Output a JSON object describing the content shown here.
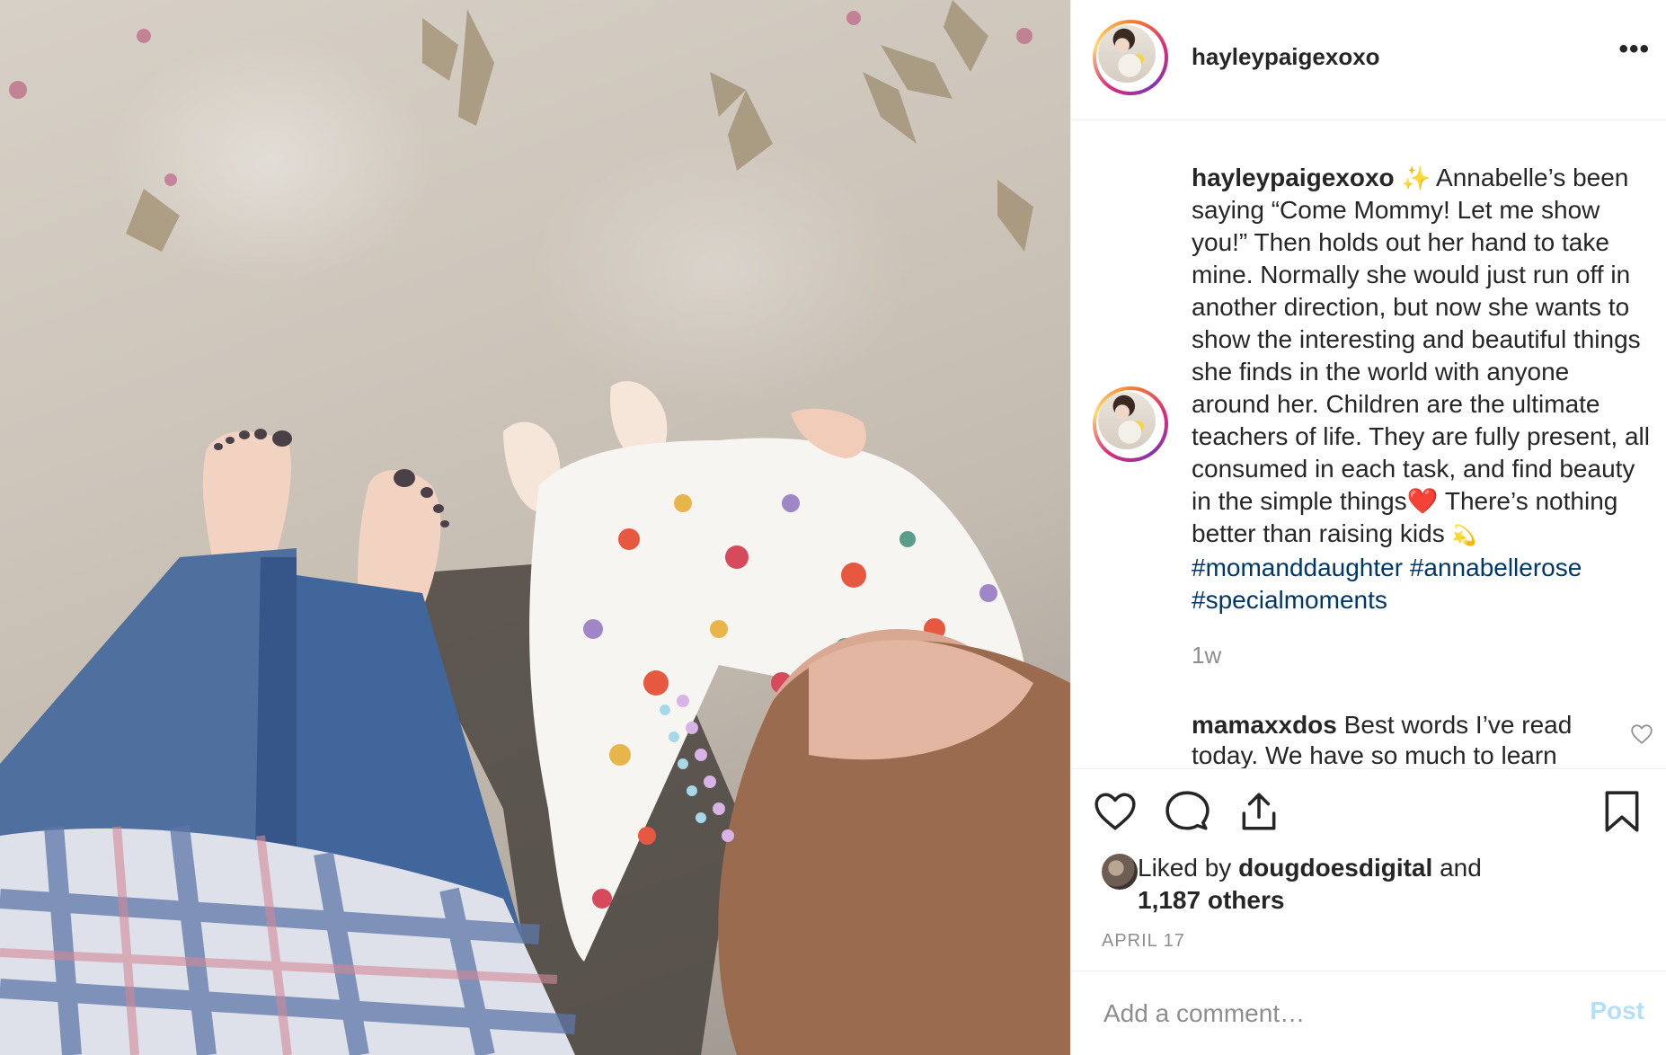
{
  "post": {
    "username": "hayleypaigexoxo",
    "more_label": "•••",
    "caption": {
      "username": "hayleypaigexoxo",
      "sparkle": "✨",
      "text": "Annabelle’s been saying “Come Mommy! Let me show you!” Then holds out her hand to take mine. Normally she would just run off in another direction, but now she wants to show the interesting and beautiful things she finds in the world with anyone around her. Children are the ultimate teachers of life. They are fully present, all consumed in each task, and find beauty in the simple things",
      "heart": "❤️",
      "text2": "There’s nothing better than raising kids",
      "dizzy": "💫",
      "hashtags": [
        "#momanddaughter",
        "#annabellerose",
        "#specialmoments"
      ]
    },
    "time_ago": "1w",
    "comment": {
      "username": "mamaxxdos",
      "text": "Best words I’ve read today. We have so much to learn"
    },
    "likes": {
      "prefix": "Liked by",
      "user": "dougdoesdigital",
      "and": "and",
      "others": "1,187 others"
    },
    "date": "APRIL 17",
    "add_comment_placeholder": "Add a comment…",
    "post_label": "Post"
  },
  "icons": {
    "like": "heart-icon",
    "comment": "comment-bubble-icon",
    "share": "share-icon",
    "save": "bookmark-icon",
    "comment_like": "small-heart-icon"
  },
  "colors": {
    "text": "#262626",
    "muted": "#8e8e8e",
    "hashtag": "#00376b",
    "post_disabled": "#b2dffc",
    "border": "#efefef"
  }
}
